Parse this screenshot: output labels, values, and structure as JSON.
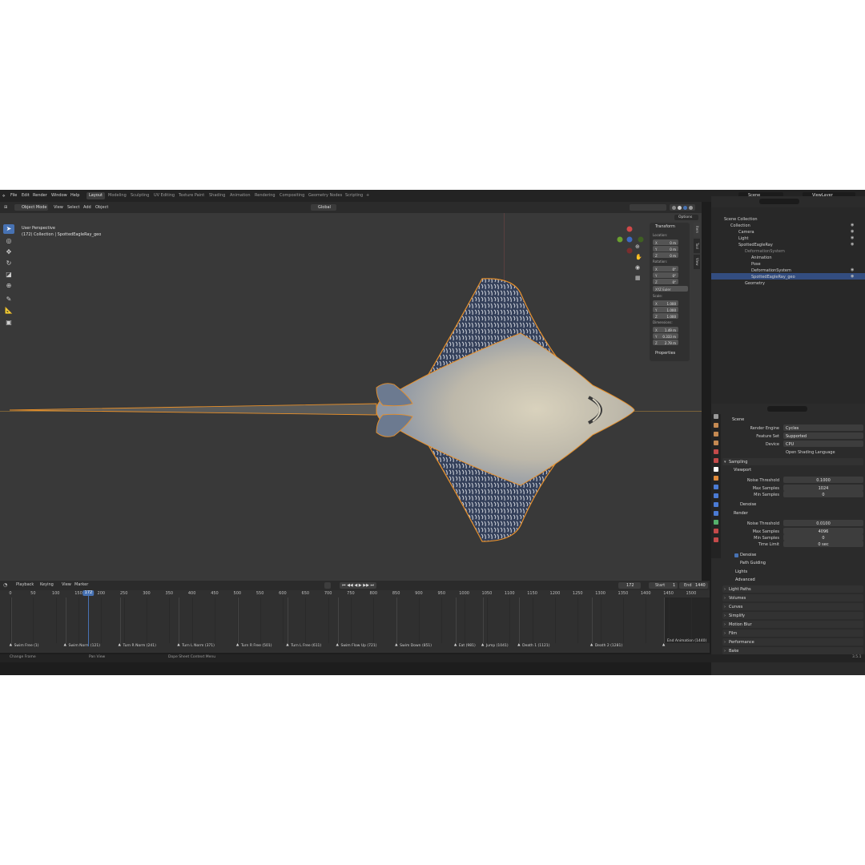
{
  "topbar": {
    "menus": [
      "File",
      "Edit",
      "Render",
      "Window",
      "Help"
    ],
    "workspaces": [
      "Layout",
      "Modeling",
      "Sculpting",
      "UV Editing",
      "Texture Paint",
      "Shading",
      "Animation",
      "Rendering",
      "Compositing",
      "Geometry Nodes",
      "Scripting"
    ],
    "add_tab": "+",
    "scene_label": "Scene",
    "viewlayer_label": "ViewLayer"
  },
  "viewport_header": {
    "mode": "Object Mode",
    "menus": [
      "View",
      "Select",
      "Add",
      "Object"
    ],
    "orientation": "Global",
    "options": "Options"
  },
  "viewport": {
    "perspective": "User Perspective",
    "collection_info": "(172) Collection | SpottedEagleRay_geo"
  },
  "npanel": {
    "tabs": [
      "Item",
      "Tool",
      "View"
    ],
    "transform_title": "Transform",
    "location_label": "Location:",
    "location": [
      {
        "axis": "X",
        "value": "0 m"
      },
      {
        "axis": "Y",
        "value": "0 m"
      },
      {
        "axis": "Z",
        "value": "0 m"
      }
    ],
    "rotation_label": "Rotation:",
    "rotation": [
      {
        "axis": "X",
        "value": "0°"
      },
      {
        "axis": "Y",
        "value": "0°"
      },
      {
        "axis": "Z",
        "value": "0°"
      }
    ],
    "rotation_mode": "XYZ Euler",
    "scale_label": "Scale:",
    "scale": [
      {
        "axis": "X",
        "value": "1.000"
      },
      {
        "axis": "Y",
        "value": "1.000"
      },
      {
        "axis": "Z",
        "value": "1.000"
      }
    ],
    "dimensions_label": "Dimensions:",
    "dimensions": [
      {
        "axis": "X",
        "value": "1.49 m"
      },
      {
        "axis": "Y",
        "value": "0.333 m"
      },
      {
        "axis": "Z",
        "value": "2.79 m"
      }
    ],
    "properties_title": "Properties"
  },
  "outliner": {
    "rows": [
      {
        "label": "Scene Collection",
        "indent": 0
      },
      {
        "label": "Collection",
        "indent": 1
      },
      {
        "label": "Camera",
        "indent": 2
      },
      {
        "label": "Light",
        "indent": 2
      },
      {
        "label": "SpottedEagleRay",
        "indent": 2
      },
      {
        "label": "DeformationSystem",
        "indent": 3
      },
      {
        "label": "Animation",
        "indent": 4
      },
      {
        "label": "Pose",
        "indent": 4
      },
      {
        "label": "DeformationSystem",
        "indent": 4
      },
      {
        "label": "SpottedEagleRay_geo",
        "indent": 4
      },
      {
        "label": "Geometry",
        "indent": 3
      }
    ]
  },
  "properties": {
    "scene": "Scene",
    "render_engine_label": "Render Engine",
    "render_engine": "Cycles",
    "feature_set_label": "Feature Set",
    "feature_set": "Supported",
    "device_label": "Device",
    "device": "CPU",
    "osl": "Open Shading Language",
    "sampling": "Sampling",
    "viewport": "Viewport",
    "noise_threshold_label": "Noise Threshold",
    "vp_noise_threshold": "0.1000",
    "max_samples_label": "Max Samples",
    "vp_max_samples": "1024",
    "min_samples_label": "Min Samples",
    "vp_min_samples": "0",
    "denoise": "Denoise",
    "render": "Render",
    "r_noise_threshold": "0.0100",
    "r_max_samples": "4096",
    "r_min_samples": "0",
    "time_limit_label": "Time Limit",
    "r_time_limit": "0 sec",
    "path_guiding": "Path Guiding",
    "lights": "Lights",
    "advanced": "Advanced",
    "sections": [
      "Light Paths",
      "Volumes",
      "Curves",
      "Simplify",
      "Motion Blur",
      "Film",
      "Performance",
      "Bake"
    ]
  },
  "timeline": {
    "menus": [
      "Playback",
      "Keying",
      "View",
      "Marker"
    ],
    "current_frame": "172",
    "start_label": "Start",
    "start": "1",
    "end_label": "End",
    "end": "1440",
    "frames": [
      "0",
      "50",
      "100",
      "150",
      "200",
      "250",
      "300",
      "350",
      "400",
      "450",
      "500",
      "550",
      "600",
      "650",
      "700",
      "750",
      "800",
      "850",
      "900",
      "950",
      "1000",
      "1050",
      "1100",
      "1150",
      "1200",
      "1250",
      "1300",
      "1350",
      "1400",
      "1450",
      "1500"
    ],
    "markers": [
      {
        "label": "Swim Free (1)",
        "frame": 1
      },
      {
        "label": "Swim Norm (121)",
        "frame": 121
      },
      {
        "label": "Turn R Norm (241)",
        "frame": 241
      },
      {
        "label": "Turn L Norm (371)",
        "frame": 371
      },
      {
        "label": "Turn R Free (501)",
        "frame": 501
      },
      {
        "label": "Turn L Free (611)",
        "frame": 611
      },
      {
        "label": "Swim Flow Up (721)",
        "frame": 721
      },
      {
        "label": "Swim Down (851)",
        "frame": 851
      },
      {
        "label": "Eat (981)",
        "frame": 981
      },
      {
        "label": "Jump (1041)",
        "frame": 1041
      },
      {
        "label": "Death 1 (1121)",
        "frame": 1121
      },
      {
        "label": "Death 2 (1281)",
        "frame": 1281
      },
      {
        "label": "End Animation (1440)",
        "frame": 1440
      }
    ]
  },
  "statusbar": {
    "items": [
      "Change Frame",
      "Pan View",
      "Dope Sheet Context Menu"
    ],
    "version": "3.5.1"
  },
  "colors": {
    "accent": "#4772b3",
    "selection_outline": "#e8902a",
    "bg": "#393939"
  }
}
